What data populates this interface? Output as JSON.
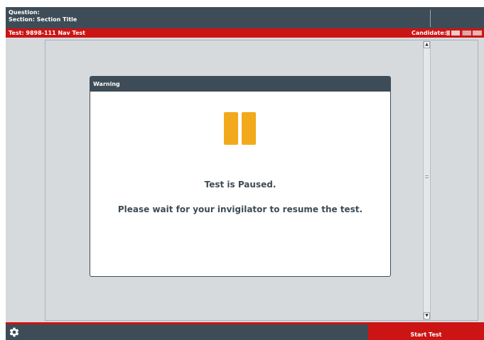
{
  "header": {
    "question_label": "Question:",
    "section_label": "Section: Section Title"
  },
  "redbar": {
    "test_label": "Test: 9898-111 Nav Test",
    "candidate_label": "Candidate:"
  },
  "dialog": {
    "title": "Warning",
    "message_primary": "Test is Paused.",
    "message_secondary": "Please wait for your invigilator to resume the test."
  },
  "footer": {
    "start_label": "Start Test",
    "settings_icon": "gear-icon"
  },
  "colors": {
    "header_bg": "#3d4c56",
    "accent_red": "#cc1414",
    "pause_orange": "#f2a91c",
    "panel_bg": "#d7dadd"
  }
}
